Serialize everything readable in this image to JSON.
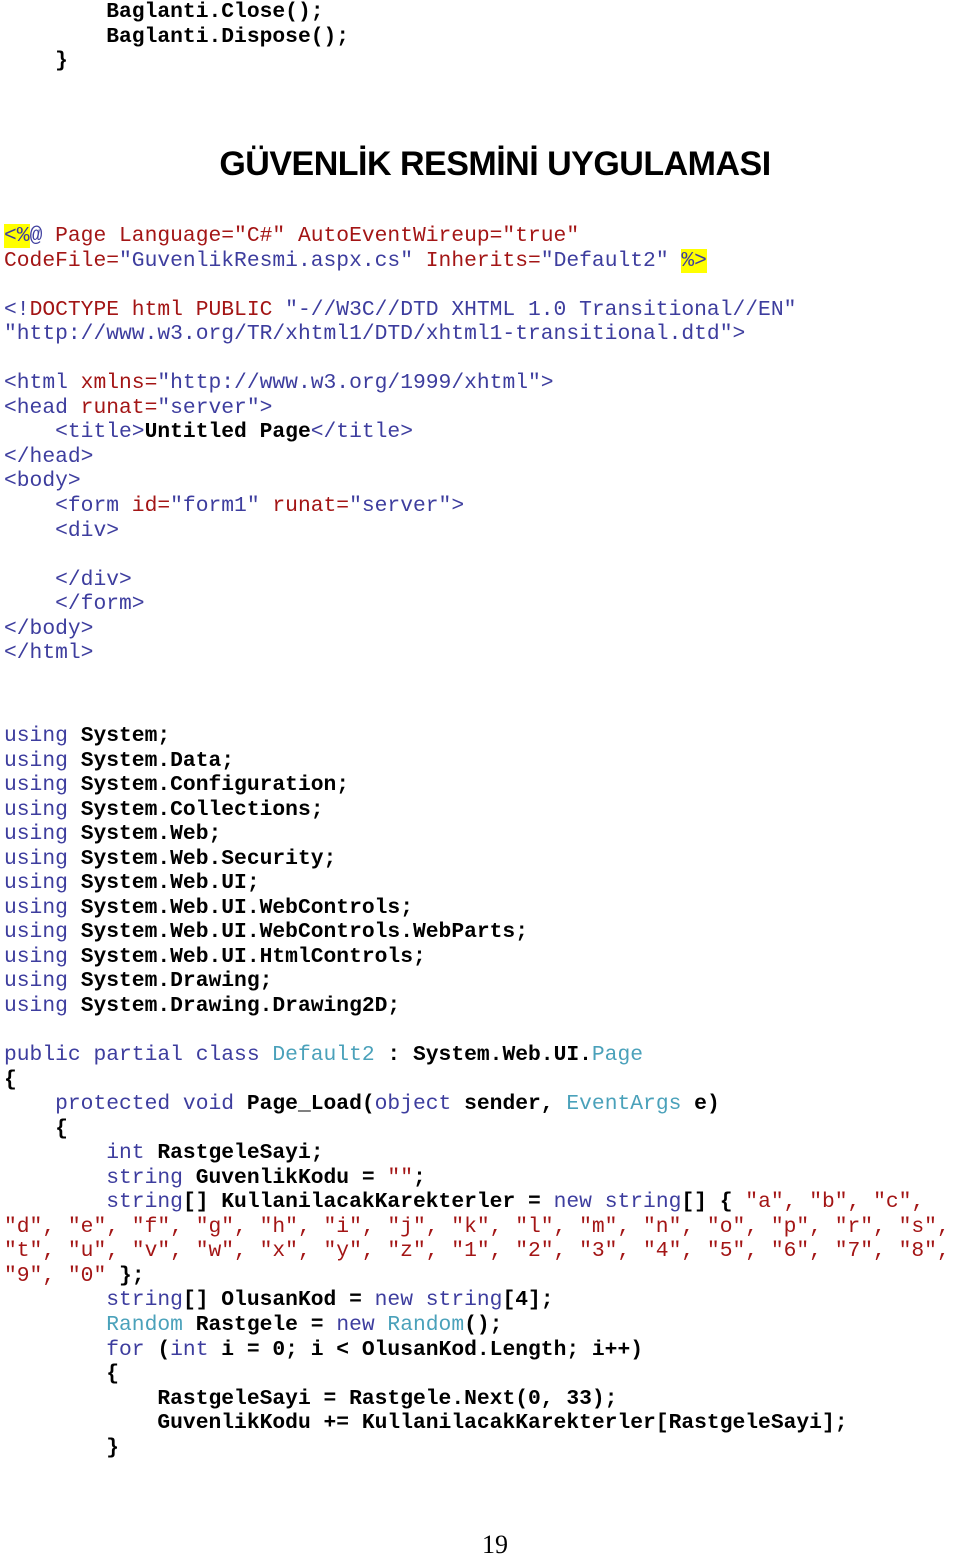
{
  "prev_code": {
    "l1": "Baglanti.Close();",
    "l2": "Baglanti.Dispose();",
    "l3": "}"
  },
  "section_title": "GÜVENLİK RESMİNİ UYGULAMASI",
  "aspx": {
    "directive_open": "<%",
    "directive_at": "@",
    "directive_l1": " Page Language=\"C#\" AutoEventWireup=\"true\"",
    "directive_l2_attr1": "CodeFile=",
    "directive_l2_val1": "\"GuvenlikResmi.aspx.cs\"",
    "directive_l2_attr2": " Inherits=",
    "directive_l2_val2": "\"Default2\"",
    "directive_close": "%>",
    "doctype_l1_a": "<!",
    "doctype_l1_b": "DOCTYPE html PUBLIC",
    "doctype_l1_c": " \"-//W3C//DTD XHTML 1.0 Transitional//EN\"",
    "doctype_l2": "\"http://www.w3.org/TR/xhtml1/DTD/xhtml1-transitional.dtd\">",
    "html_open_a": "<html",
    "html_open_b": " xmlns=",
    "html_open_c": "\"http://www.w3.org/1999/xhtml\">",
    "head_open_a": "<head",
    "head_open_b": " runat=",
    "head_open_c": "\"server\">",
    "title_open": "    <title>",
    "title_text": "Untitled Page",
    "title_close": "</title>",
    "head_close": "</head>",
    "body_open": "<body>",
    "form_a": "    <form",
    "form_b": " id=",
    "form_c": "\"form1\"",
    "form_d": " runat=",
    "form_e": "\"server\">",
    "div_open": "    <div>",
    "div_close": "    </div>",
    "form_close": "    </form>",
    "body_close": "</body>",
    "html_close": "</html>"
  },
  "usings": [
    "System;",
    "System.Data;",
    "System.Configuration;",
    "System.Collections;",
    "System.Web;",
    "System.Web.Security;",
    "System.Web.UI;",
    "System.Web.UI.WebControls;",
    "System.Web.UI.WebControls.WebParts;",
    "System.Web.UI.HtmlControls;",
    "System.Drawing;",
    "System.Drawing.Drawing2D;"
  ],
  "using_kw": "using",
  "csharp": {
    "class_kw": "public partial class",
    "class_name": "Default2",
    "class_base_a": " : System.Web.UI.",
    "class_base_b": "Page",
    "open_brace": "{",
    "method_kw": "protected void",
    "method_name": " Page_Load(",
    "param1_type": "object",
    "param1_name": " sender, ",
    "param2_type": "EventArgs",
    "param2_name": " e)",
    "int_kw": "int",
    "var1": " RastgeleSayi;",
    "string_kw": "string",
    "var2": " GuvenlikKodu = ",
    "var2_val": "\"\"",
    "var2_end": ";",
    "array_kw": "string",
    "array_decl": "[] KullanilacakKarekterler = ",
    "new_kw": "new",
    "array_type": "string",
    "array_open": "[] { ",
    "array_l1": "\"a\", \"b\", \"c\",",
    "array_l2": "\"d\", \"e\", \"f\", \"g\", \"h\", \"i\", \"j\", \"k\", \"l\", \"m\", \"n\", \"o\", \"p\", \"r\", \"s\",",
    "array_l3": "\"t\", \"u\", \"v\", \"w\", \"x\", \"y\", \"z\", \"1\", \"2\", \"3\", \"4\", \"5\", \"6\", \"7\", \"8\",",
    "array_l4": "\"9\", \"0\"",
    "array_end": " };",
    "olusan_kw": "string",
    "olusan_decl": "[] OlusanKod = ",
    "olusan_new": "new",
    "olusan_type": " string",
    "olusan_end": "[4];",
    "random_type": "Random",
    "random_decl": " Rastgele = ",
    "random_new": "new",
    "random_type2": " Random",
    "random_end": "();",
    "for_kw": "for",
    "for_open": " (",
    "for_int": "int",
    "for_rest": " i = 0; i < OlusanKod.Length; i++)",
    "loop_open": "{",
    "loop_l1": "RastgeleSayi = Rastgele.Next(0, 33);",
    "loop_l2": "GuvenlikKodu += KullanilacakKarekterler[RastgeleSayi];",
    "loop_close": "}"
  },
  "page_number": "19"
}
